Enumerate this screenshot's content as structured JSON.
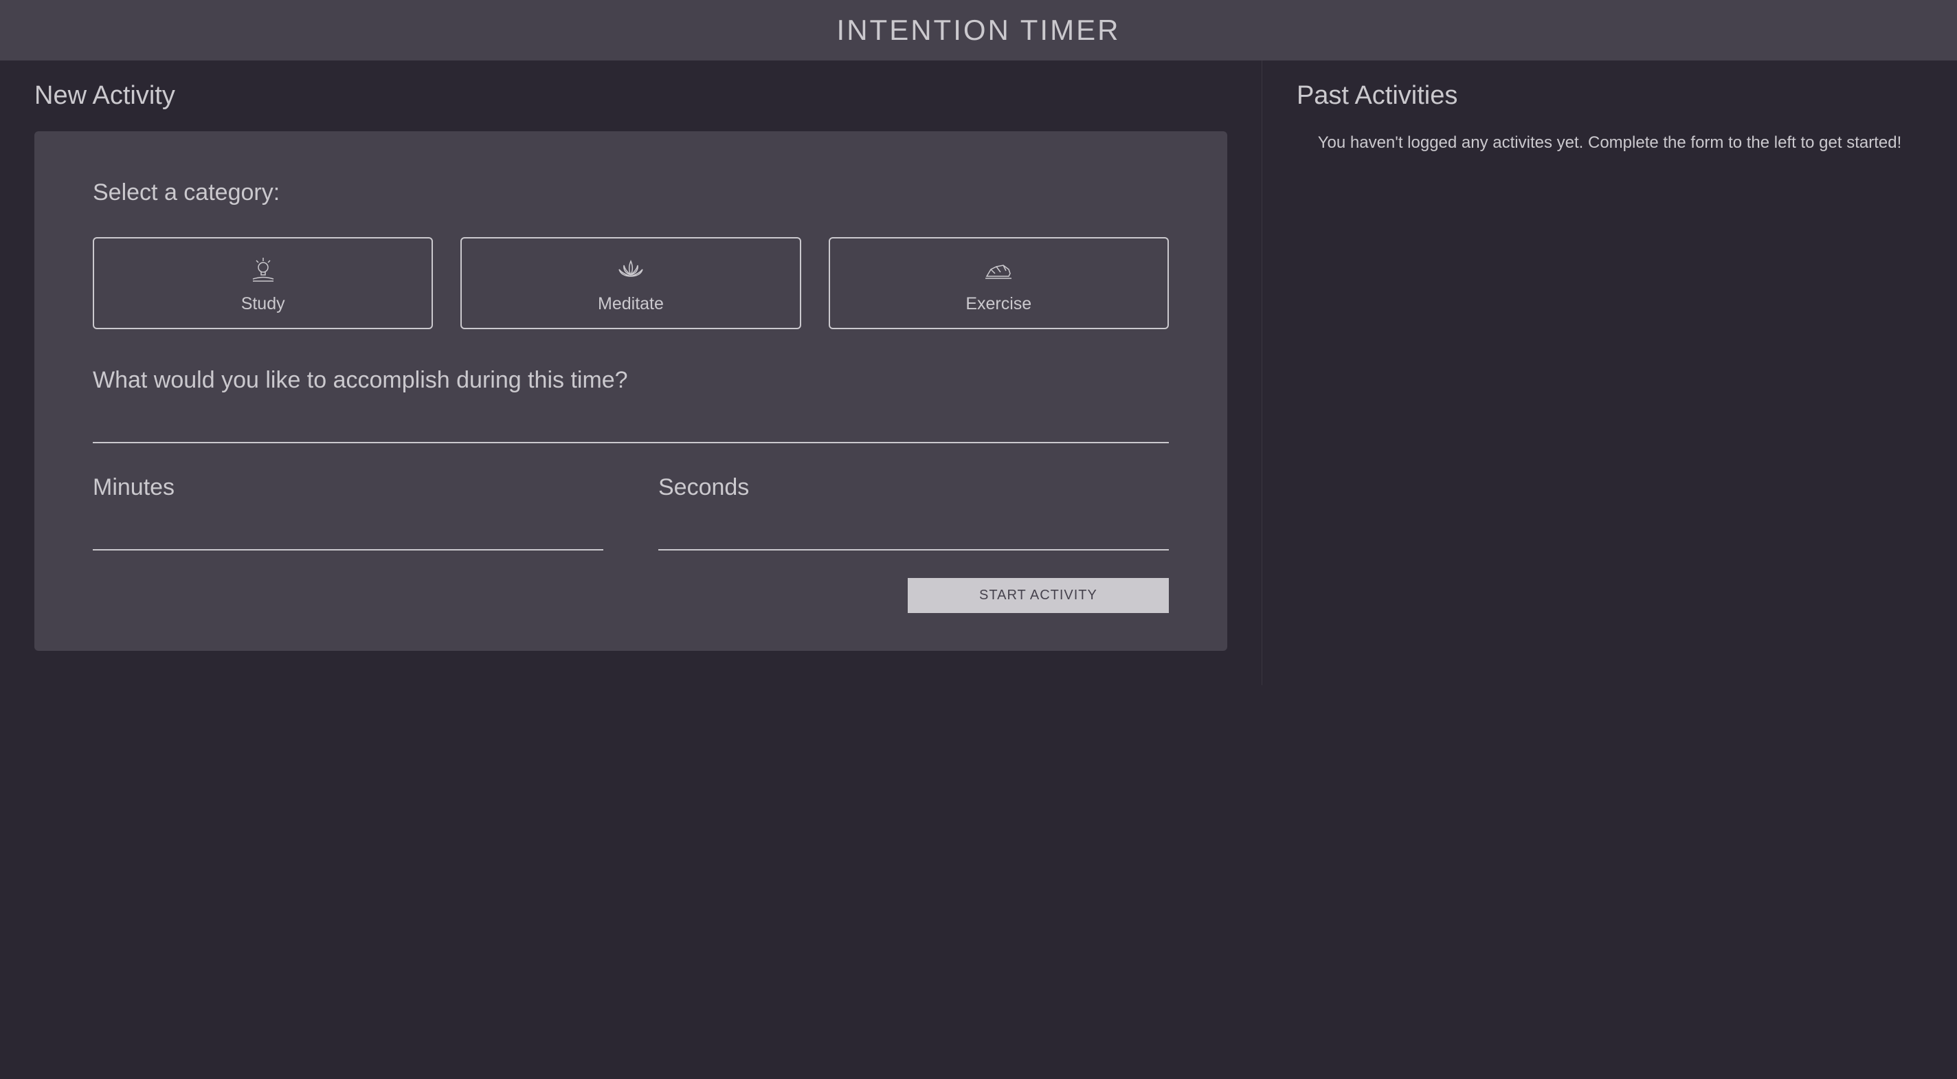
{
  "header": {
    "title": "INTENTION TIMER"
  },
  "newActivity": {
    "title": "New Activity",
    "selectCategoryLabel": "Select a category:",
    "categories": [
      {
        "label": "Study"
      },
      {
        "label": "Meditate"
      },
      {
        "label": "Exercise"
      }
    ],
    "accomplishLabel": "What would you like to accomplish during this time?",
    "accomplishValue": "",
    "minutesLabel": "Minutes",
    "minutesValue": "",
    "secondsLabel": "Seconds",
    "secondsValue": "",
    "startButtonLabel": "START ACTIVITY"
  },
  "pastActivities": {
    "title": "Past Activities",
    "emptyMessage": "You haven't logged any activites yet. Complete the form to the left to get started!"
  }
}
